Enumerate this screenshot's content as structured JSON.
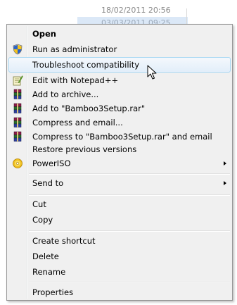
{
  "background": {
    "rows": [
      "18/02/2011 20:56",
      "03/03/2011 09:25"
    ]
  },
  "menu": {
    "items": [
      {
        "label": "Open",
        "icon": "none",
        "bold": true
      },
      {
        "label": "Run as administrator",
        "icon": "uac-shield-icon"
      },
      {
        "label": "Troubleshoot compatibility",
        "icon": "none",
        "hover": true
      },
      {
        "label": "Edit with Notepad++",
        "icon": "notepad-plus-plus-icon"
      },
      {
        "label": "Add to archive...",
        "icon": "winrar-icon"
      },
      {
        "label": "Add to \"Bamboo3Setup.rar\"",
        "icon": "winrar-icon"
      },
      {
        "label": "Compress and email...",
        "icon": "winrar-icon"
      },
      {
        "label": "Compress to \"Bamboo3Setup.rar\" and email",
        "icon": "winrar-icon"
      },
      {
        "label": "Restore previous versions",
        "icon": "none"
      },
      {
        "label": "PowerISO",
        "icon": "poweriso-icon",
        "submenu": true
      },
      {
        "label": "Send to",
        "icon": "none",
        "submenu": true
      },
      {
        "label": "Cut",
        "icon": "none"
      },
      {
        "label": "Copy",
        "icon": "none"
      },
      {
        "label": "Create shortcut",
        "icon": "none"
      },
      {
        "label": "Delete",
        "icon": "none"
      },
      {
        "label": "Rename",
        "icon": "none"
      },
      {
        "label": "Properties",
        "icon": "none"
      }
    ]
  },
  "colors": {
    "menu_bg": "#f0f0f0",
    "hover_border": "#a8d8f3",
    "hover_fill": "#e2eefa"
  }
}
